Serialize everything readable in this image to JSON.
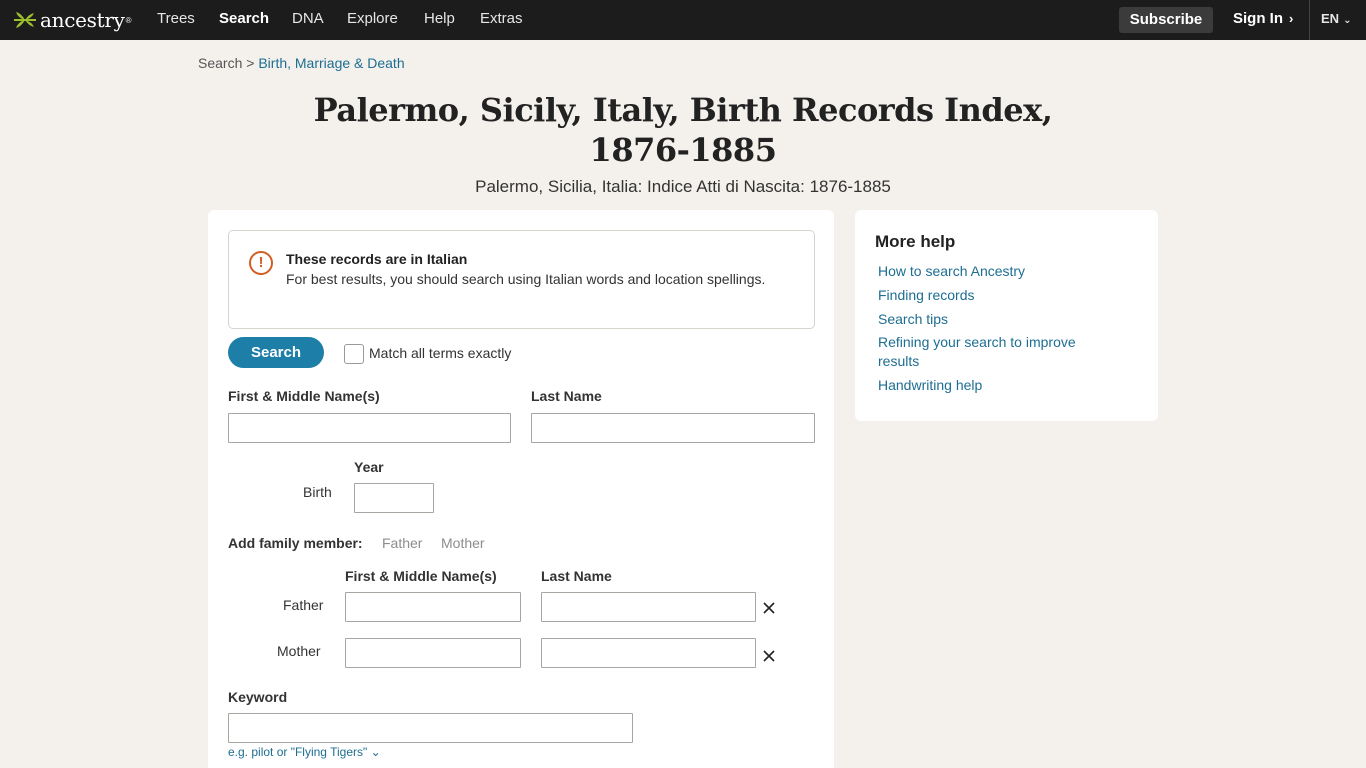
{
  "nav": {
    "logo_text": "ancestry",
    "logo_tm": "®",
    "items": [
      {
        "label": "Trees"
      },
      {
        "label": "Search"
      },
      {
        "label": "DNA"
      },
      {
        "label": "Explore"
      },
      {
        "label": "Help"
      },
      {
        "label": "Extras"
      }
    ],
    "subscribe": "Subscribe",
    "sign_in": "Sign In",
    "language": "EN"
  },
  "breadcrumb": {
    "root": "Search",
    "separator": ">",
    "current": "Birth, Marriage & Death"
  },
  "page": {
    "title": "Palermo, Sicily, Italy, Birth Records Index, 1876-1885",
    "subtitle": "Palermo, Sicilia, Italia: Indice Atti di Nascita: 1876-1885"
  },
  "notice": {
    "icon": "alert-circle-icon",
    "title": "These records are in Italian",
    "body": "For best results, you should search using Italian words and location spellings."
  },
  "form": {
    "search_button": "Search",
    "match_exact_label": "Match all terms exactly",
    "match_exact_checked": false,
    "first_name_label": "First & Middle Name(s)",
    "first_name_value": "",
    "last_name_label": "Last Name",
    "last_name_value": "",
    "birth_label": "Birth",
    "year_label": "Year",
    "birth_year_value": "",
    "add_family_label": "Add family member:",
    "add_father": "Father",
    "add_mother": "Mother",
    "family_first_label": "First & Middle Name(s)",
    "family_last_label": "Last Name",
    "father_label": "Father",
    "mother_label": "Mother",
    "keyword_label": "Keyword",
    "keyword_value": "",
    "keyword_hint": "e.g. pilot or \"Flying Tigers\""
  },
  "help": {
    "title": "More help",
    "links": [
      {
        "label": "How to search Ancestry"
      },
      {
        "label": "Finding records"
      },
      {
        "label": "Search tips"
      },
      {
        "label": "Refining your search to improve results"
      },
      {
        "label": "Handwriting help"
      }
    ]
  },
  "colors": {
    "nav_bg": "#1c1c1c",
    "page_bg": "#f4f1ed",
    "accent": "#1d7ea8",
    "link": "#1d6e92",
    "logo_leaf": "#9bbf2d",
    "alert": "#d05e25"
  }
}
